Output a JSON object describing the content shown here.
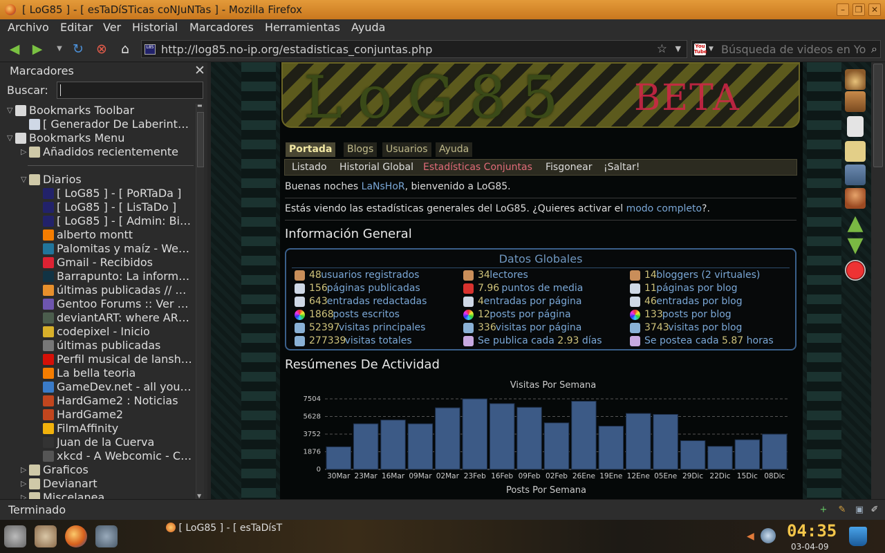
{
  "window": {
    "title": "[ LoG85 ] - [ esTaDíSTicas coNJuNTas ] - Mozilla Firefox"
  },
  "menu": [
    "Archivo",
    "Editar",
    "Ver",
    "Historial",
    "Marcadores",
    "Herramientas",
    "Ayuda"
  ],
  "nav": {
    "url": "http://log85.no-ip.org/estadisticas_conjuntas.php",
    "search_placeholder": "Búsqueda de videos en You",
    "yt_label": "You Tube"
  },
  "sidebar": {
    "title": "Marcadores",
    "search_label": "Buscar:",
    "items": [
      {
        "label": "Bookmarks Toolbar",
        "depth": 0,
        "tw": "▽",
        "icon": "bookmark-toolbar-icon"
      },
      {
        "label": "[ Generador De Laberint…",
        "depth": 1,
        "tw": "",
        "icon": "page-icon"
      },
      {
        "label": "Bookmarks Menu",
        "depth": 0,
        "tw": "▽",
        "icon": "bookmark-menu-icon"
      },
      {
        "label": "Añadidos recientemente",
        "depth": 1,
        "tw": "▷",
        "icon": "folder-icon"
      },
      {
        "label": "",
        "depth": 1,
        "tw": "",
        "icon": "separator"
      },
      {
        "label": "Diarios",
        "depth": 1,
        "tw": "▽",
        "icon": "folder-icon"
      },
      {
        "label": "[ LoG85 ] - [ PoRTaDa ]",
        "depth": 2,
        "tw": "",
        "icon": "log85-icon"
      },
      {
        "label": "[ LoG85 ] - [ LisTaDo ]",
        "depth": 2,
        "tw": "",
        "icon": "log85-icon"
      },
      {
        "label": "[ LoG85 ] - [ Admin: Bi…",
        "depth": 2,
        "tw": "",
        "icon": "log85-icon"
      },
      {
        "label": "alberto montt",
        "depth": 2,
        "tw": "",
        "icon": "blogger-icon"
      },
      {
        "label": "Palomitas y maíz - We…",
        "depth": 2,
        "tw": "",
        "icon": "wordpress-icon"
      },
      {
        "label": "Gmail - Recibidos",
        "depth": 2,
        "tw": "",
        "icon": "gmail-icon"
      },
      {
        "label": "Barrapunto: La inform…",
        "depth": 2,
        "tw": "",
        "icon": "barrapunto-icon"
      },
      {
        "label": "últimas publicadas // …",
        "depth": 2,
        "tw": "",
        "icon": "feed-icon"
      },
      {
        "label": "Gentoo Forums :: Ver …",
        "depth": 2,
        "tw": "",
        "icon": "gentoo-icon"
      },
      {
        "label": "deviantART: where AR…",
        "depth": 2,
        "tw": "",
        "icon": "deviantart-icon"
      },
      {
        "label": "codepixel - Inicio",
        "depth": 2,
        "tw": "",
        "icon": "codepixel-icon"
      },
      {
        "label": "últimas publicadas",
        "depth": 2,
        "tw": "",
        "icon": "generic-icon"
      },
      {
        "label": "Perfil musical de lansh…",
        "depth": 2,
        "tw": "",
        "icon": "lastfm-icon"
      },
      {
        "label": "La bella teoria",
        "depth": 2,
        "tw": "",
        "icon": "blogger-icon"
      },
      {
        "label": "GameDev.net - all you…",
        "depth": 2,
        "tw": "",
        "icon": "globe-icon"
      },
      {
        "label": "HardGame2 : Noticias",
        "depth": 2,
        "tw": "",
        "icon": "hardgame-icon"
      },
      {
        "label": "HardGame2",
        "depth": 2,
        "tw": "",
        "icon": "hardgame-icon"
      },
      {
        "label": "FilmAffinity",
        "depth": 2,
        "tw": "",
        "icon": "filmaffinity-icon"
      },
      {
        "label": "Juan de la Cuerva",
        "depth": 2,
        "tw": "",
        "icon": "person-icon"
      },
      {
        "label": "xkcd - A Webcomic - C…",
        "depth": 2,
        "tw": "",
        "icon": "xkcd-icon"
      },
      {
        "label": "Graficos",
        "depth": 1,
        "tw": "▷",
        "icon": "folder-icon"
      },
      {
        "label": "Devianart",
        "depth": 1,
        "tw": "▷",
        "icon": "folder-icon"
      },
      {
        "label": "Miscelanea",
        "depth": 1,
        "tw": "▷",
        "icon": "folder-icon"
      }
    ]
  },
  "page": {
    "banner_text": "LoG85",
    "banner_beta": "BETA",
    "tabs": [
      "Portada",
      "Blogs",
      "Usuarios",
      "Ayuda"
    ],
    "subnav": [
      "Listado",
      "Historial Global",
      "Estadísticas Conjuntas",
      "Fisgonear",
      "¡Saltar!"
    ],
    "greeting": {
      "pre": "Buenas noches ",
      "user": "LaNsHoR",
      "post": ", bienvenido a LoG85."
    },
    "intro": {
      "pre": "Estás viendo las estadísticas generales del LoG85. ¿Quieres activar el ",
      "link": "modo completo",
      "post": "?."
    },
    "info_title": "Información General",
    "datos_title": "Datos Globales",
    "stats": [
      [
        {
          "v": "48",
          "l": " usuarios registrados",
          "icon": "users-icon",
          "c": "#c98e5a"
        },
        {
          "v": "156",
          "l": " páginas publicadas",
          "icon": "page-icon",
          "c": "#cfd8e6"
        },
        {
          "v": "643",
          "l": " entradas redactadas",
          "icon": "page-icon",
          "c": "#cfd8e6"
        },
        {
          "v": "1868",
          "l": " posts escritos",
          "icon": "color-wheel-icon",
          "c": "#e6a23c"
        },
        {
          "v": "52397",
          "l": " visitas principales",
          "icon": "visitors-icon",
          "c": "#8ab1d6"
        },
        {
          "v": "277339",
          "l": " visitas totales",
          "icon": "visitors-icon",
          "c": "#8ab1d6"
        }
      ],
      [
        {
          "v": "34",
          "l": " lectores",
          "icon": "reader-icon",
          "c": "#c98e5a"
        },
        {
          "v": "7.96",
          "l": " puntos de media",
          "icon": "medal-icon",
          "c": "#d8322e"
        },
        {
          "v": "4",
          "l": " entradas por página",
          "icon": "page-icon",
          "c": "#cfd8e6"
        },
        {
          "v": "12",
          "l": " posts por página",
          "icon": "color-wheel-icon",
          "c": "#e6a23c"
        },
        {
          "v": "336",
          "l": " visitas por página",
          "icon": "visitors-icon",
          "c": "#8ab1d6"
        },
        {
          "v": "",
          "l": "Se publica cada 2.93 días",
          "icon": "pen-icon",
          "c": "#c7a9e0"
        }
      ],
      [
        {
          "v": "14",
          "l": " bloggers (2 virtuales)",
          "icon": "blogger-user-icon",
          "c": "#c98e5a"
        },
        {
          "v": "11",
          "l": " páginas por blog",
          "icon": "page-icon",
          "c": "#cfd8e6"
        },
        {
          "v": "46",
          "l": " entradas por blog",
          "icon": "page-icon",
          "c": "#cfd8e6"
        },
        {
          "v": "133",
          "l": " posts por blog",
          "icon": "color-wheel-icon",
          "c": "#e6a23c"
        },
        {
          "v": "3743",
          "l": " visitas por blog",
          "icon": "visitors-icon",
          "c": "#8ab1d6"
        },
        {
          "v": "",
          "l": "Se postea cada 5.87 horas",
          "icon": "pen-icon",
          "c": "#c7a9e0"
        }
      ]
    ],
    "activity_title": "Resúmenes De Actividad",
    "next_chart_title": "Posts Por Semana"
  },
  "chart_data": {
    "type": "bar",
    "title": "Visitas Por Semana",
    "categories": [
      "30Mar",
      "23Mar",
      "16Mar",
      "09Mar",
      "02Mar",
      "23Feb",
      "16Feb",
      "09Feb",
      "02Feb",
      "26Ene",
      "19Ene",
      "12Ene",
      "05Ene",
      "29Dic",
      "22Dic",
      "15Dic",
      "08Dic"
    ],
    "values": [
      2400,
      4850,
      5250,
      4850,
      6550,
      7504,
      7000,
      6600,
      4950,
      7250,
      4600,
      5950,
      5850,
      3050,
      2450,
      3150,
      3750
    ],
    "yticks": [
      0,
      1876,
      3752,
      5628,
      7504
    ],
    "ylim": [
      0,
      7504
    ],
    "color": "#3c5a86",
    "grid": true
  },
  "status": {
    "text": "Terminado"
  },
  "taskbar": {
    "window_title": "[ LoG85 ] - [ esTaDísT",
    "clock": "04:35",
    "date": "03-04-09"
  }
}
